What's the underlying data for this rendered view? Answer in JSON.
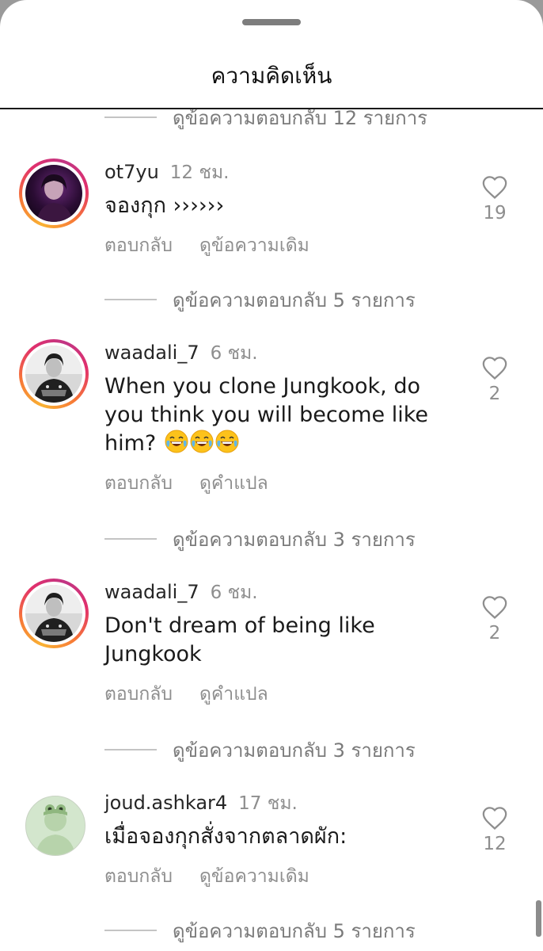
{
  "header": {
    "title": "ความคิดเห็น"
  },
  "view_replies": [
    "ดูข้อความตอบกลับ 12 รายการ",
    "ดูข้อความตอบกลับ 5 รายการ",
    "ดูข้อความตอบกลับ 3 รายการ",
    "ดูข้อความตอบกลับ 3 รายการ",
    "ดูข้อความตอบกลับ 5 รายการ"
  ],
  "comments": [
    {
      "username": "ot7yu",
      "time": "12 ชม.",
      "text": "จองกุก ››››››",
      "reply_label": "ตอบกลับ",
      "secondary_label": "ดูข้อความเดิม",
      "likes": "19"
    },
    {
      "username": "waadali_7",
      "time": "6 ชม.",
      "text": "When you clone Jungkook, do you think you will become like him?",
      "reply_label": "ตอบกลับ",
      "secondary_label": "ดูคำแปล",
      "likes": "2"
    },
    {
      "username": "waadali_7",
      "time": "6 ชม.",
      "text": "Don't dream of being like Jungkook",
      "reply_label": "ตอบกลับ",
      "secondary_label": "ดูคำแปล",
      "likes": "2"
    },
    {
      "username": "joud.ashkar4",
      "time": "17 ชม.",
      "text": "เมื่อจองกุกสั่งจากตลาดผัก:",
      "reply_label": "ตอบกลับ",
      "secondary_label": "ดูข้อความเดิม",
      "likes": "12"
    }
  ],
  "icons": {
    "like": "heart-outline-icon",
    "emoji": "face-with-tears-of-joy"
  },
  "colors": {
    "story_ring": "#e1306c",
    "meta_text": "#8e8e8e"
  }
}
